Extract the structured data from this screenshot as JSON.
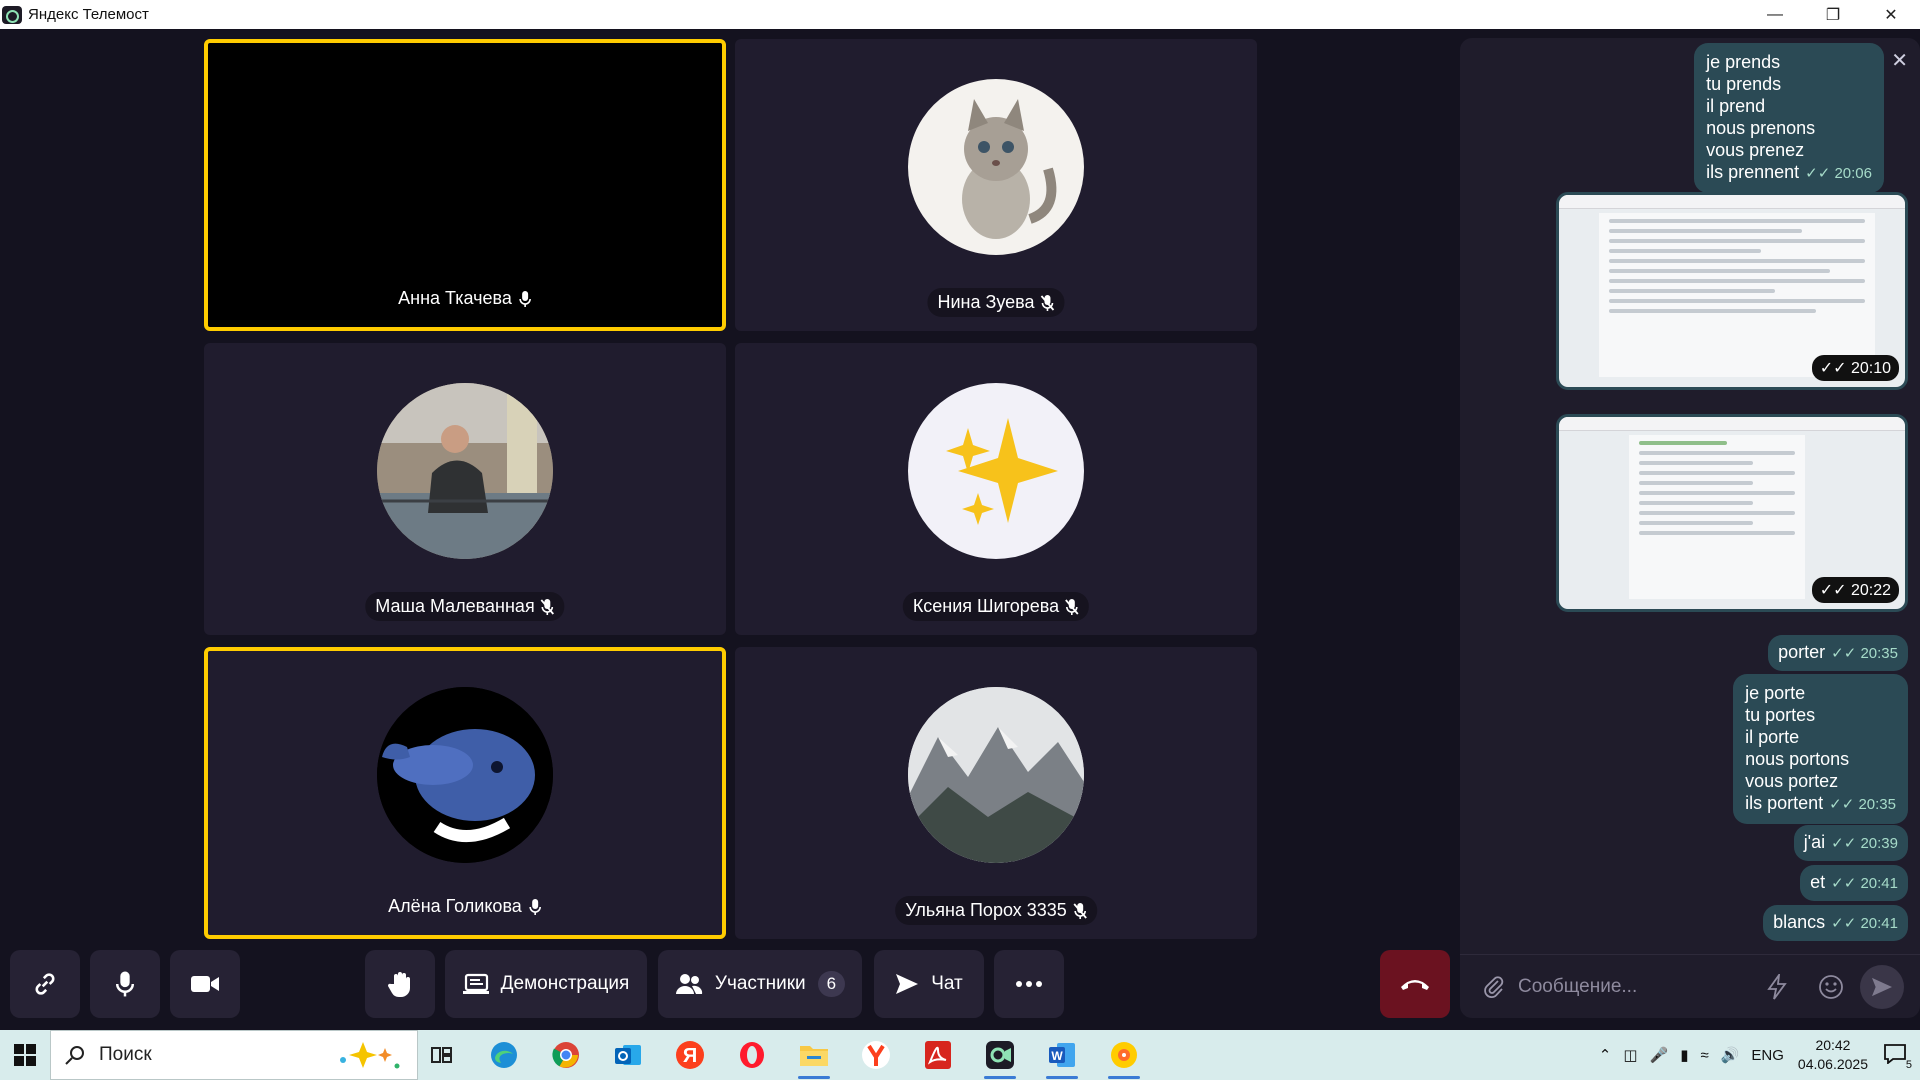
{
  "window": {
    "title": "Яндекс Телемост",
    "controls": [
      "minimize",
      "restore",
      "close"
    ]
  },
  "participants": [
    {
      "name": "Анна Ткачева",
      "mic": "on",
      "active": true,
      "avatar": "camera-off-black"
    },
    {
      "name": "Нина Зуева",
      "mic": "off",
      "active": false,
      "avatar": "kitten-drawing"
    },
    {
      "name": "Маша Малеванная",
      "mic": "off",
      "active": false,
      "avatar": "person-photo"
    },
    {
      "name": "Ксения Шигорева",
      "mic": "off",
      "active": false,
      "avatar": "sparkles-emoji"
    },
    {
      "name": "Алёна Голикова",
      "mic": "on",
      "active": true,
      "avatar": "blue-dolphin"
    },
    {
      "name": "Ульяна Порох 3335",
      "mic": "off",
      "active": false,
      "avatar": "mountains-photo"
    }
  ],
  "toolbar": {
    "link_icon": "link-icon",
    "mic_icon": "microphone-icon",
    "camera_icon": "camera-icon",
    "hand_icon": "raise-hand-icon",
    "demo_label": "Демонстрация",
    "participants_label": "Участники",
    "participants_count": "6",
    "chat_label": "Чат",
    "more_icon": "more-icon",
    "hangup_icon": "hangup-icon"
  },
  "chat": {
    "messages": [
      {
        "type": "text",
        "lines": [
          "je prends",
          "tu prends",
          "il prend",
          "nous prenons",
          "vous prenez",
          "ils prennent"
        ],
        "time": "20:06"
      },
      {
        "type": "image",
        "time": "20:10"
      },
      {
        "type": "image",
        "time": "20:22"
      },
      {
        "type": "text",
        "lines": [
          "porter"
        ],
        "time": "20:35"
      },
      {
        "type": "text",
        "lines": [
          "je porte",
          "tu portes",
          "il porte",
          "nous portons",
          "vous portez",
          "ils portent"
        ],
        "time": "20:35"
      },
      {
        "type": "text",
        "lines": [
          "j'ai"
        ],
        "time": "20:39"
      },
      {
        "type": "text",
        "lines": [
          "et"
        ],
        "time": "20:41"
      },
      {
        "type": "text",
        "lines": [
          "blancs"
        ],
        "time": "20:41"
      }
    ],
    "input_placeholder": "Сообщение..."
  },
  "taskbar": {
    "search_label": "Поиск",
    "apps": [
      "task-view-icon",
      "edge-icon",
      "chrome-icon",
      "outlook-icon",
      "yandex-icon",
      "opera-icon",
      "file-explorer-icon",
      "yandex-browser-icon",
      "acrobat-icon",
      "telemost-icon",
      "word-icon",
      "yandex-music-icon"
    ],
    "language": "ENG",
    "time": "20:42",
    "date": "04.06.2025",
    "notifications": "5"
  },
  "colors": {
    "active_border": "#ffcc00",
    "tile_bg": "#201c2e",
    "bubble": "#2b4a55",
    "hangup": "#6b1220"
  }
}
